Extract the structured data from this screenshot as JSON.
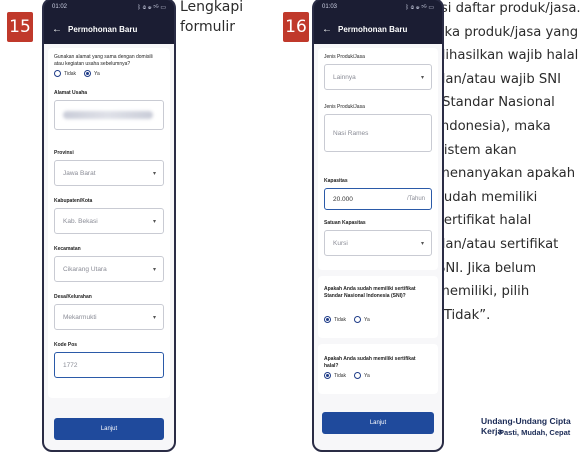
{
  "step15": {
    "number": "15",
    "caption": [
      "Lengkapi",
      "formulir"
    ],
    "status_time": "01:02",
    "status_icons": "ᛒ ◎ ☏ ⁵ᴳ ▭",
    "appbar_title": "Permohonan Baru",
    "question": "Gunakan alamat yang sama dengan domisili atau kegiatan usaha sebelumnya?",
    "radio_tidak": "Tidak",
    "radio_ya": "Ya",
    "alamat_label": "Alamat Usaha",
    "provinsi_label": "Provinsi",
    "provinsi_value": "Jawa Barat",
    "kabupaten_label": "Kabupaten/Kota",
    "kabupaten_value": "Kab. Bekasi",
    "kecamatan_label": "Kecamatan",
    "kecamatan_value": "Cikarang Utara",
    "desa_label": "Desa/Kelurahan",
    "desa_value": "Mekarmukti",
    "kodepos_label": "Kode Pos",
    "kodepos_value": "1772",
    "button": "Lanjut"
  },
  "step16": {
    "number": "16",
    "caption": [
      "Isi daftar produk/jasa.",
      "Jika produk/jasa yang",
      "dihasilkan wajib halal",
      "dan/atau wajib SNI",
      "(Standar Nasional",
      "Indonesia), maka",
      "sistem akan",
      "menanyakan apakah",
      "sudah memiliki",
      "sertifikat halal",
      "dan/atau sertifikat",
      "SNI. Jika belum",
      "memiliki, pilih",
      "“Tidak”."
    ],
    "status_time": "01:03",
    "status_icons": "ᛒ ◎ ☏ ⁵ᴳ ▭",
    "appbar_title": "Permohonan Baru",
    "jenis_label": "Jenis Produk/Jasa",
    "jenis_value": "Lainnya",
    "produk_label": "Jenis Produk/Jasa",
    "produk_value": "Nasi Rames",
    "kapasitas_label": "Kapasitas",
    "kapasitas_value": "20.000",
    "kapasitas_suffix": "/Tahun",
    "satuan_label": "Satuan Kapasitas",
    "satuan_value": "Kursi",
    "sni_question": "Apakah Anda sudah memiliki sertifikat Standar Nasional Indonesia (SNI)?",
    "halal_question": "Apakah Anda sudah memiliki sertifikat halal?",
    "radio_tidak": "Tidak",
    "radio_ya": "Ya",
    "button": "Lanjut"
  },
  "footer": {
    "line1": "Undang-Undang Cipta Kerja",
    "line2": "Pasti, Mudah, Cepat"
  },
  "colors": {
    "badge": "#c0392b",
    "phone_header": "#1b1d33",
    "button": "#1f4a9c",
    "radio": "#1f3c88"
  }
}
